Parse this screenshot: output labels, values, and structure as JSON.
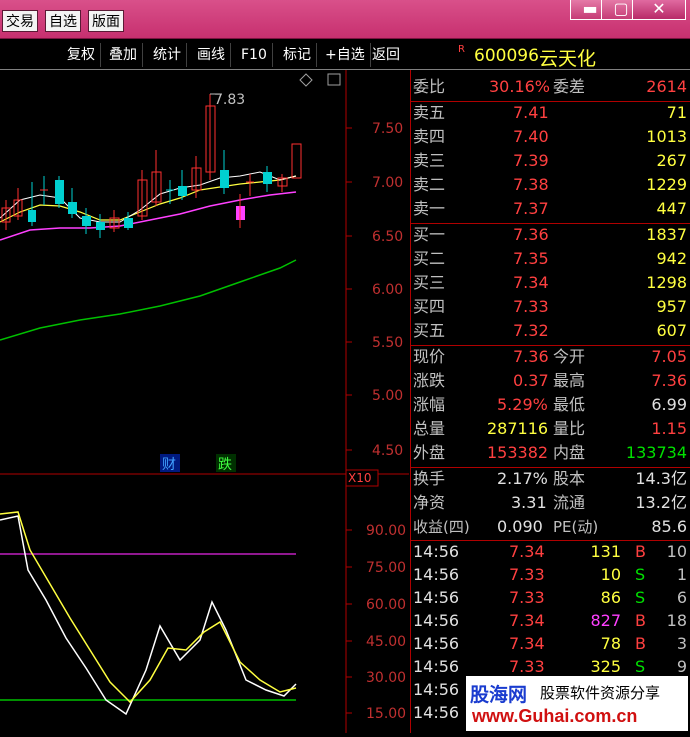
{
  "titlebar": {
    "buttons": [
      "交易",
      "自选",
      "版面"
    ],
    "min": "▬",
    "max": "▢",
    "close": "✕"
  },
  "toolbar": {
    "items": [
      "复权",
      "叠加",
      "统计",
      "画线",
      "F10",
      "标记",
      "+自选",
      "返回"
    ]
  },
  "stock": {
    "badge": "R",
    "code": "600096",
    "name": "云天化"
  },
  "chart_data": {
    "type": "candlestick",
    "price_axis": [
      "7.50",
      "7.00",
      "6.50",
      "6.00",
      "5.50",
      "5.00",
      "4.50"
    ],
    "peak_label": "7.83",
    "markers": [
      "财",
      "跌"
    ],
    "indicator_badge": "X10",
    "indicator_axis": [
      "90.00",
      "75.00",
      "60.00",
      "45.00",
      "30.00",
      "15.00"
    ]
  },
  "quote": {
    "weibi_label": "委比",
    "weibi": "30.16%",
    "weicha_label": "委差",
    "weicha": "2614",
    "asks": [
      {
        "label": "卖五",
        "price": "7.41",
        "vol": "71"
      },
      {
        "label": "卖四",
        "price": "7.40",
        "vol": "1013"
      },
      {
        "label": "卖三",
        "price": "7.39",
        "vol": "267"
      },
      {
        "label": "卖二",
        "price": "7.38",
        "vol": "1229"
      },
      {
        "label": "卖一",
        "price": "7.37",
        "vol": "447"
      }
    ],
    "bids": [
      {
        "label": "买一",
        "price": "7.36",
        "vol": "1837"
      },
      {
        "label": "买二",
        "price": "7.35",
        "vol": "942"
      },
      {
        "label": "买三",
        "price": "7.34",
        "vol": "1298"
      },
      {
        "label": "买四",
        "price": "7.33",
        "vol": "957"
      },
      {
        "label": "买五",
        "price": "7.32",
        "vol": "607"
      }
    ],
    "stats": [
      {
        "l1": "现价",
        "v1": "7.36",
        "l2": "今开",
        "v2": "7.05"
      },
      {
        "l1": "涨跌",
        "v1": "0.37",
        "l2": "最高",
        "v2": "7.36"
      },
      {
        "l1": "涨幅",
        "v1": "5.29%",
        "l2": "最低",
        "v2": "6.99"
      },
      {
        "l1": "总量",
        "v1": "287116",
        "l2": "量比",
        "v2": "1.15"
      },
      {
        "l1": "外盘",
        "v1": "153382",
        "l2": "内盘",
        "v2": "133734"
      }
    ],
    "fund": [
      {
        "l1": "换手",
        "v1": "2.17%",
        "l2": "股本",
        "v2": "14.3亿"
      },
      {
        "l1": "净资",
        "v1": "3.31",
        "l2": "流通",
        "v2": "13.2亿"
      },
      {
        "l1": "收益(四)",
        "v1": "0.090",
        "l2": "PE(动)",
        "v2": "85.6"
      }
    ]
  },
  "ticks": [
    {
      "time": "14:56",
      "price": "7.34",
      "vol": "131",
      "side": "B",
      "num": "10"
    },
    {
      "time": "14:56",
      "price": "7.33",
      "vol": "10",
      "side": "S",
      "num": "1"
    },
    {
      "time": "14:56",
      "price": "7.33",
      "vol": "86",
      "side": "S",
      "num": "6"
    },
    {
      "time": "14:56",
      "price": "7.34",
      "vol": "827",
      "side": "B",
      "num": "18"
    },
    {
      "time": "14:56",
      "price": "7.34",
      "vol": "78",
      "side": "B",
      "num": "3"
    },
    {
      "time": "14:56",
      "price": "7.33",
      "vol": "325",
      "side": "S",
      "num": "9"
    },
    {
      "time": "14:56",
      "price": "",
      "vol": "",
      "side": "",
      "num": ""
    },
    {
      "time": "14:56",
      "price": "",
      "vol": "",
      "side": "",
      "num": ""
    }
  ],
  "watermark": {
    "brand": "股海网",
    "tagline": "股票软件资源分享",
    "url": "www.Guhai.com.cn"
  }
}
